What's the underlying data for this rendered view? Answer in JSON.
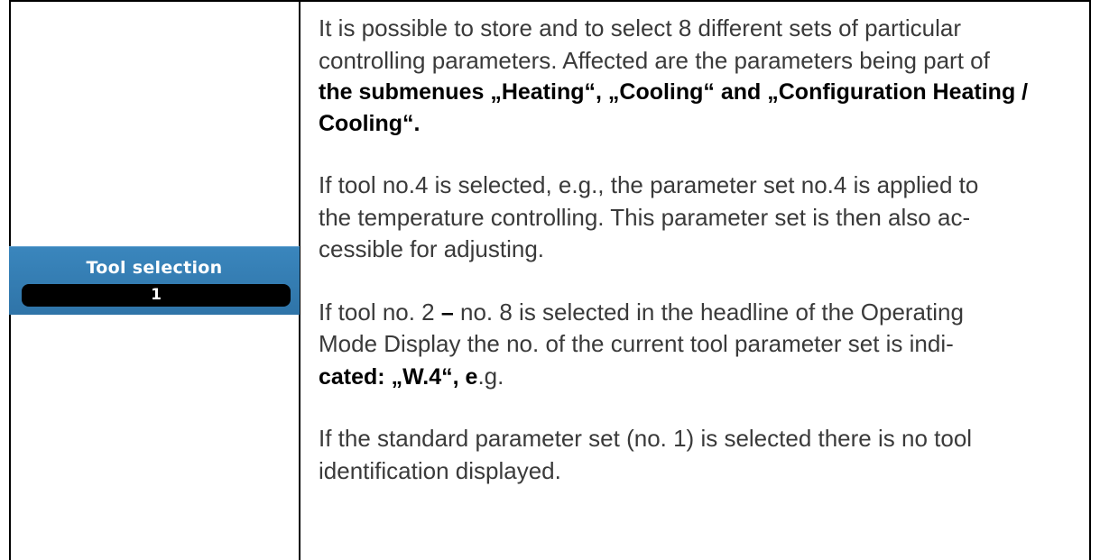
{
  "widget": {
    "title": "Tool selection",
    "value": "1"
  },
  "paragraphs": {
    "p1_a": "It is possible to store and to select 8 different sets of particular\ncontrolling parameters. Affected are the parameters being part of\n",
    "p1_b": "the submenues „Heating“, „Cooling“ and „Configuration Heating /\nCooling“.",
    "p2": "If tool no.4 is selected, e.g., the parameter set no.4 is applied to\nthe temperature controlling. This parameter set is then also ac-\ncessible for adjusting.",
    "p3_a": "If tool no. 2 ",
    "p3_dash": "–",
    "p3_b": " no. 8 is selected in the headline of the Operating\nMode Display the no. of the current tool parameter set is indi-\n",
    "p3_c": "cated: „W.4“, e",
    "p3_d": ".g.",
    "p4": "If the standard parameter set (no. 1) is selected there is no tool\nidentification displayed."
  }
}
